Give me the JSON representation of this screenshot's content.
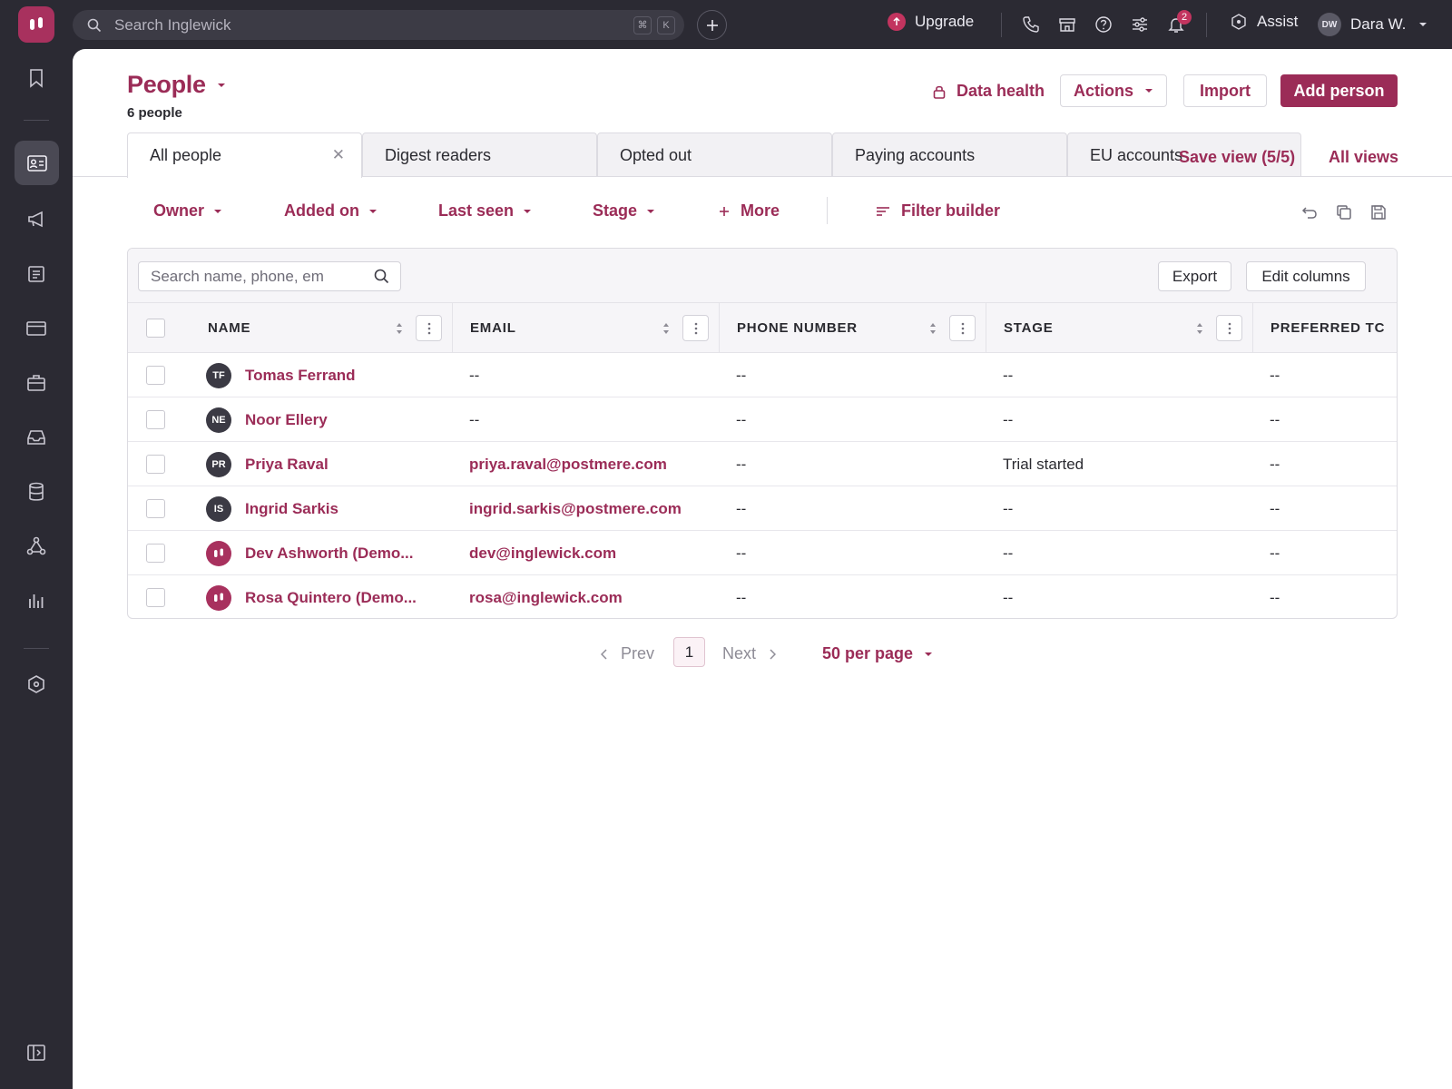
{
  "topbar": {
    "search_placeholder": "Search Inglewick",
    "kbd_cmd": "⌘",
    "kbd_k": "K",
    "upgrade_label": "Upgrade",
    "notification_count": "2",
    "assist_label": "Assist",
    "user_initials": "DW",
    "user_name": "Dara W."
  },
  "page": {
    "title": "People",
    "count": "6 people",
    "data_health": "Data health",
    "actions_label": "Actions",
    "import_label": "Import",
    "add_label": "Add person"
  },
  "tabs": [
    {
      "label": "All people"
    },
    {
      "label": "Digest readers"
    },
    {
      "label": "Opted out"
    },
    {
      "label": "Paying accounts"
    },
    {
      "label": "EU accounts"
    }
  ],
  "save_view": "Save view (5/5)",
  "all_views": "All views",
  "filters": {
    "owner": "Owner",
    "added_on": "Added on",
    "last_seen": "Last seen",
    "stage": "Stage",
    "more": "More",
    "builder": "Filter builder"
  },
  "table": {
    "search_placeholder": "Search name, phone, em",
    "export_label": "Export",
    "edit_columns_label": "Edit columns",
    "columns": [
      "NAME",
      "EMAIL",
      "PHONE NUMBER",
      "STAGE",
      "PREFERRED TC"
    ],
    "rows": [
      {
        "initials": "TF",
        "name": "Tomas Ferrand",
        "email": "--",
        "phone": "--",
        "stage": "--",
        "preferred": "--"
      },
      {
        "initials": "NE",
        "name": "Noor Ellery",
        "email": "--",
        "phone": "--",
        "stage": "--",
        "preferred": "--"
      },
      {
        "initials": "PR",
        "name": "Priya Raval",
        "email": "priya.raval@postmere.com",
        "phone": "--",
        "stage": "Trial started",
        "preferred": "--"
      },
      {
        "initials": "IS",
        "name": "Ingrid Sarkis",
        "email": "ingrid.sarkis@postmere.com",
        "phone": "--",
        "stage": "--",
        "preferred": "--"
      },
      {
        "initials": "",
        "name": "Dev Ashworth (Demo...",
        "email": "dev@inglewick.com",
        "phone": "--",
        "stage": "--",
        "preferred": "--"
      },
      {
        "initials": "",
        "name": "Rosa Quintero (Demo...",
        "email": "rosa@inglewick.com",
        "phone": "--",
        "stage": "--",
        "preferred": "--"
      }
    ]
  },
  "pagination": {
    "prev": "Prev",
    "page": "1",
    "next": "Next",
    "per_page": "50 per page"
  },
  "colors": {
    "brand": "#9b2c57",
    "sidebar_bg": "#2b2a33"
  }
}
